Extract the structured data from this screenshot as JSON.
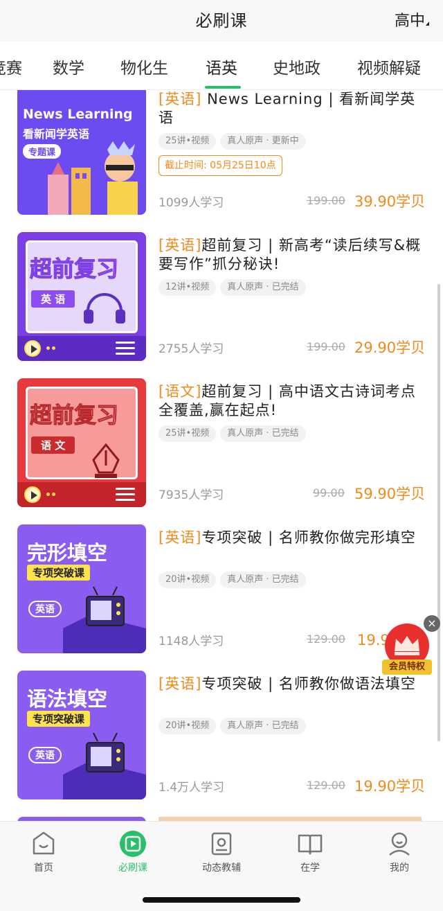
{
  "header": {
    "title": "必刷课",
    "grade": "高中"
  },
  "tabs": [
    {
      "label": "竞赛",
      "active": false
    },
    {
      "label": "数学",
      "active": false
    },
    {
      "label": "物化生",
      "active": false
    },
    {
      "label": "语英",
      "active": true
    },
    {
      "label": "史地政",
      "active": false
    },
    {
      "label": "视频解疑",
      "active": false
    }
  ],
  "courses": [
    {
      "subject": "[英语]",
      "title": " News Learning | 看新闻学英语",
      "tags": [
        "25讲•视频",
        "真人原声 · 更新中"
      ],
      "deadline": "截止时间: 05月25日10点",
      "learners": "1099人学习",
      "original_price": "199.00",
      "price": "39.90学贝",
      "cover": {
        "line1": "News Learning",
        "line2": "看新闻学英语",
        "badge": "专题课"
      }
    },
    {
      "subject": "[英语]",
      "title": "超前复习 | 新高考“读后续写&概要写作”抓分秘诀!",
      "tags": [
        "12讲•视频",
        "真人原声 · 已完结"
      ],
      "learners": "2755人学习",
      "original_price": "199.00",
      "price": "29.90学贝",
      "cover": {
        "line1": "超前复习",
        "badge": "英 语"
      }
    },
    {
      "subject": "[语文]",
      "title": "超前复习 | 高中语文古诗词考点全覆盖,赢在起点!",
      "tags": [
        "25讲•视频",
        "真人原声 · 已完结"
      ],
      "learners": "7935人学习",
      "original_price": "99.00",
      "price": "59.90学贝",
      "cover": {
        "line1": "超前复习",
        "badge": "语 文"
      }
    },
    {
      "subject": "[英语]",
      "title": "专项突破 | 名师教你做完形填空",
      "tags": [
        "20讲•视频",
        "真人原声 · 已完结"
      ],
      "learners": "1148人学习",
      "original_price": "129.00",
      "price": "19.90学贝",
      "cover": {
        "line1": "完形填空",
        "line2": "专项突破课",
        "badge": "英语"
      }
    },
    {
      "subject": "[英语]",
      "title": "专项突破 | 名师教你做语法填空",
      "tags": [
        "20讲•视频",
        "真人原声 · 已完结"
      ],
      "learners": "1.4万人学习",
      "original_price": "129.00",
      "price": "19.90学贝",
      "cover": {
        "line1": "语法填空",
        "line2": "专项突破课",
        "badge": "英语"
      }
    }
  ],
  "member_badge": {
    "label": "会员特权",
    "close": "×"
  },
  "bottom_nav": [
    {
      "label": "首页",
      "icon": "home-icon",
      "active": false
    },
    {
      "label": "必刷课",
      "icon": "play-icon",
      "active": true
    },
    {
      "label": "动态教辅",
      "icon": "tutorial-icon",
      "active": false
    },
    {
      "label": "在学",
      "icon": "book-icon",
      "active": false
    },
    {
      "label": "我的",
      "icon": "profile-icon",
      "active": false
    }
  ],
  "colors": {
    "accent": "#28c06a",
    "price": "#f08a1c",
    "subject": "#f08a1c"
  }
}
